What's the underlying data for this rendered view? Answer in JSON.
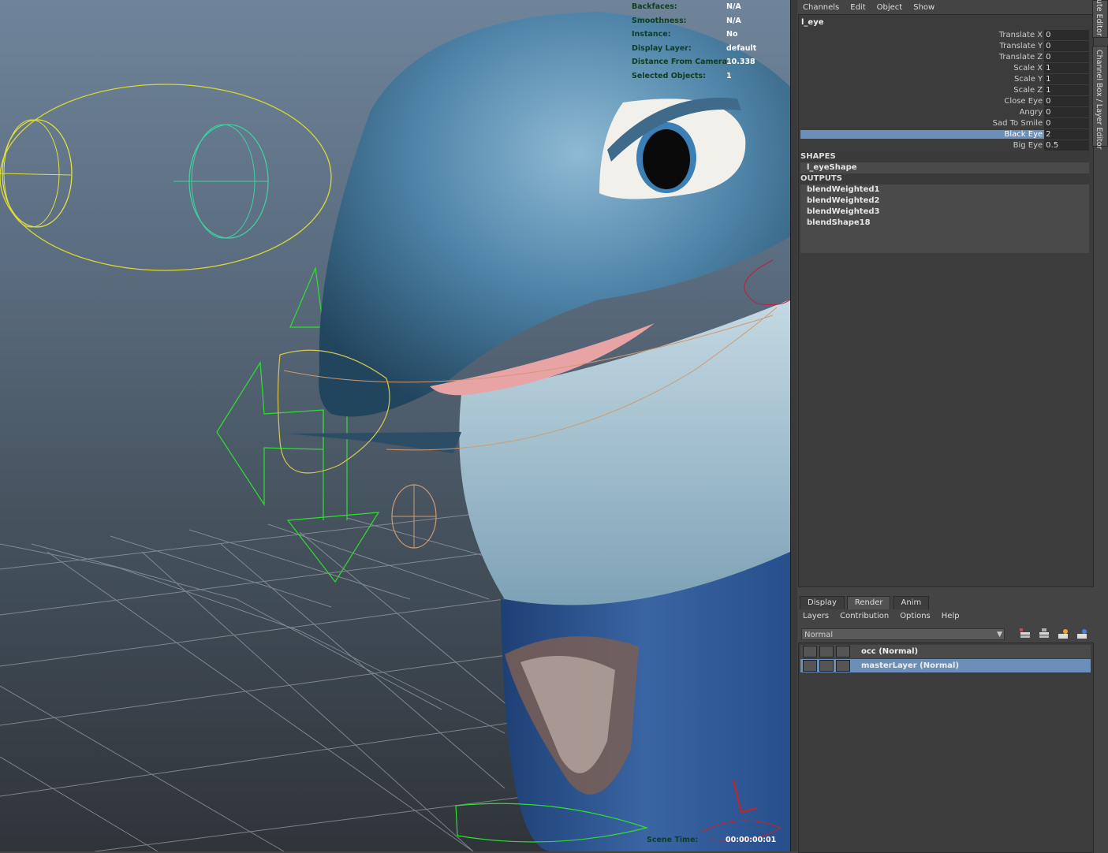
{
  "hud": {
    "rows": [
      {
        "k": "Backfaces:",
        "v": "N/A"
      },
      {
        "k": "Smoothness:",
        "v": "N/A"
      },
      {
        "k": "Instance:",
        "v": "No"
      },
      {
        "k": "Display Layer:",
        "v": "default"
      },
      {
        "k": "Distance From Camera:",
        "v": "10.338"
      },
      {
        "k": "Selected Objects:",
        "v": "1"
      }
    ],
    "scene_time_label": "Scene Time:",
    "scene_time_value": "00:00:00:01"
  },
  "channel_box": {
    "menu": [
      "Channels",
      "Edit",
      "Object",
      "Show"
    ],
    "object": "l_eye",
    "attributes": [
      {
        "label": "Translate X",
        "value": "0"
      },
      {
        "label": "Translate Y",
        "value": "0"
      },
      {
        "label": "Translate Z",
        "value": "0"
      },
      {
        "label": "Scale X",
        "value": "1"
      },
      {
        "label": "Scale Y",
        "value": "1"
      },
      {
        "label": "Scale Z",
        "value": "1"
      },
      {
        "label": "Close Eye",
        "value": "0"
      },
      {
        "label": "Angry",
        "value": "0"
      },
      {
        "label": "Sad To Smile",
        "value": "0"
      },
      {
        "label": "Black Eye",
        "value": "2"
      },
      {
        "label": "Big Eye",
        "value": "0.5"
      }
    ],
    "shapes_header": "SHAPES",
    "shapes": [
      "l_eyeShape"
    ],
    "outputs_header": "OUTPUTS",
    "outputs": [
      "blendWeighted1",
      "blendWeighted2",
      "blendWeighted3",
      "blendShape18"
    ]
  },
  "side_tabs": {
    "top": "ute Editor",
    "main": "Channel Box / Layer Editor"
  },
  "layer_editor": {
    "tabs": [
      "Display",
      "Render",
      "Anim"
    ],
    "active_tab": "Render",
    "menu": [
      "Layers",
      "Contribution",
      "Options",
      "Help"
    ],
    "blend_mode": "Normal",
    "layers": [
      {
        "name": "occ (Normal)"
      },
      {
        "name": "masterLayer (Normal)"
      }
    ]
  },
  "colors": {
    "selection": "#6b8fb8",
    "panel": "#444444",
    "hud_label": "#0f3d22"
  }
}
